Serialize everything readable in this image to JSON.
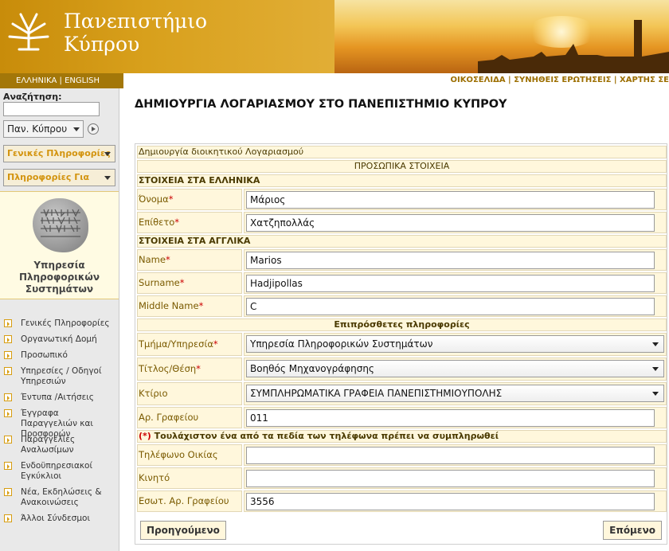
{
  "header": {
    "logo_line1": "Πανεπιστήμιο",
    "logo_line2": "Κύπρου",
    "language": "ΕΛΛΗΝΙΚΑ | ENGLISH",
    "top_links": "ΟΙΚΟΣΕΛΙΔΑ | ΣΥΝΗΘΕΙΣ ΕΡΩΤΗΣΕΙΣ | ΧΑΡΤΗΣ ΣΕ"
  },
  "sidebar": {
    "search_label": "Αναζήτηση:",
    "search_value": "",
    "scope_select": "Παν. Κύπρου",
    "menu1": "Γενικές Πληροφορίες",
    "menu2": "Πληροφορίες Για",
    "service_title": "Υπηρεσία Πληροφορικών Συστημάτων",
    "nav_items": [
      "Γενικές Πληροφορίες",
      "Οργανωτική Δομή",
      "Προσωπικό",
      "Υπηρεσίες / Οδηγοί Υπηρεσιών",
      "Έντυπα /Αιτήσεις",
      "Έγγραφα Παραγγελιών και Προσφορών",
      "Παραγγελίες Αναλωσίμων",
      "Ενδοϋπηρεσιακοί Εγκύκλιοι",
      "Νέα, Εκδηλώσεις & Ανακοινώσεις",
      "Άλλοι Σύνδεσμοι"
    ]
  },
  "main": {
    "page_title": "ΔΗΜΙΟΥΡΓΙΑ ΛΟΓΑΡΙΑΣΜΟΥ ΣΤΟ ΠΑΝΕΠΙΣΤΗΜΙΟ ΚΥΠΡΟΥ",
    "form_caption": "Δημιουργία διοικητικού Λογαριασμού",
    "section_personal": "ΠΡΟΣΩΠΙΚΑ ΣΤΟΙΧΕΙΑ",
    "section_greek": "ΣΤΟΙΧΕΙΑ ΣΤΑ ΕΛΛΗΝΙΚΑ",
    "section_english": "ΣΤΟΙΧΕΙΑ ΣΤΑ ΑΓΓΛΙΚΑ",
    "section_additional": "Επιπρόσθετες πληροφορίες",
    "phone_notice_mark": "(*)",
    "phone_notice": " Τουλάχιστον ένα από τα πεδία των τηλέφωνα πρέπει να συμπληρωθεί",
    "fields": {
      "first_name_gr": {
        "label": "Όνομα",
        "value": "Μάριος",
        "required": "*"
      },
      "last_name_gr": {
        "label": "Επίθετο",
        "value": "Χατζηπολλάς",
        "required": "*"
      },
      "first_name_en": {
        "label": "Name",
        "value": "Marios",
        "required": "*"
      },
      "last_name_en": {
        "label": "Surname",
        "value": "Hadjipollas",
        "required": "*"
      },
      "middle_name": {
        "label": "Middle Name",
        "value": "C",
        "required": "*"
      },
      "department": {
        "label": "Τμήμα/Υπηρεσία",
        "value": "Υπηρεσία Πληροφορικών Συστημάτων",
        "required": "*"
      },
      "position": {
        "label": "Τίτλος/Θέση",
        "value": "Βοηθός Μηχανογράφησης",
        "required": "*"
      },
      "building": {
        "label": "Κτίριο",
        "value": "ΣΥΜΠΛΗΡΩΜΑΤΙΚΑ ΓΡΑΦΕΙΑ ΠΑΝΕΠΙΣΤΗΜΙΟΥΠΟΛΗΣ"
      },
      "office_no": {
        "label": "Αρ. Γραφείου",
        "value": "011"
      },
      "home_phone": {
        "label": "Τηλέφωνο Οικίας",
        "value": ""
      },
      "mobile": {
        "label": "Κινητό",
        "value": ""
      },
      "office_ext": {
        "label": "Εσωτ. Αρ. Γραφείου",
        "value": "3556"
      }
    },
    "prev_button": "Προηγούμενο",
    "next_button": "Επόμενο"
  },
  "colors": {
    "accent": "#d3940f",
    "header_bg": "#d9a21a",
    "label_bg": "#fff7dc",
    "required": "#cc0000"
  }
}
